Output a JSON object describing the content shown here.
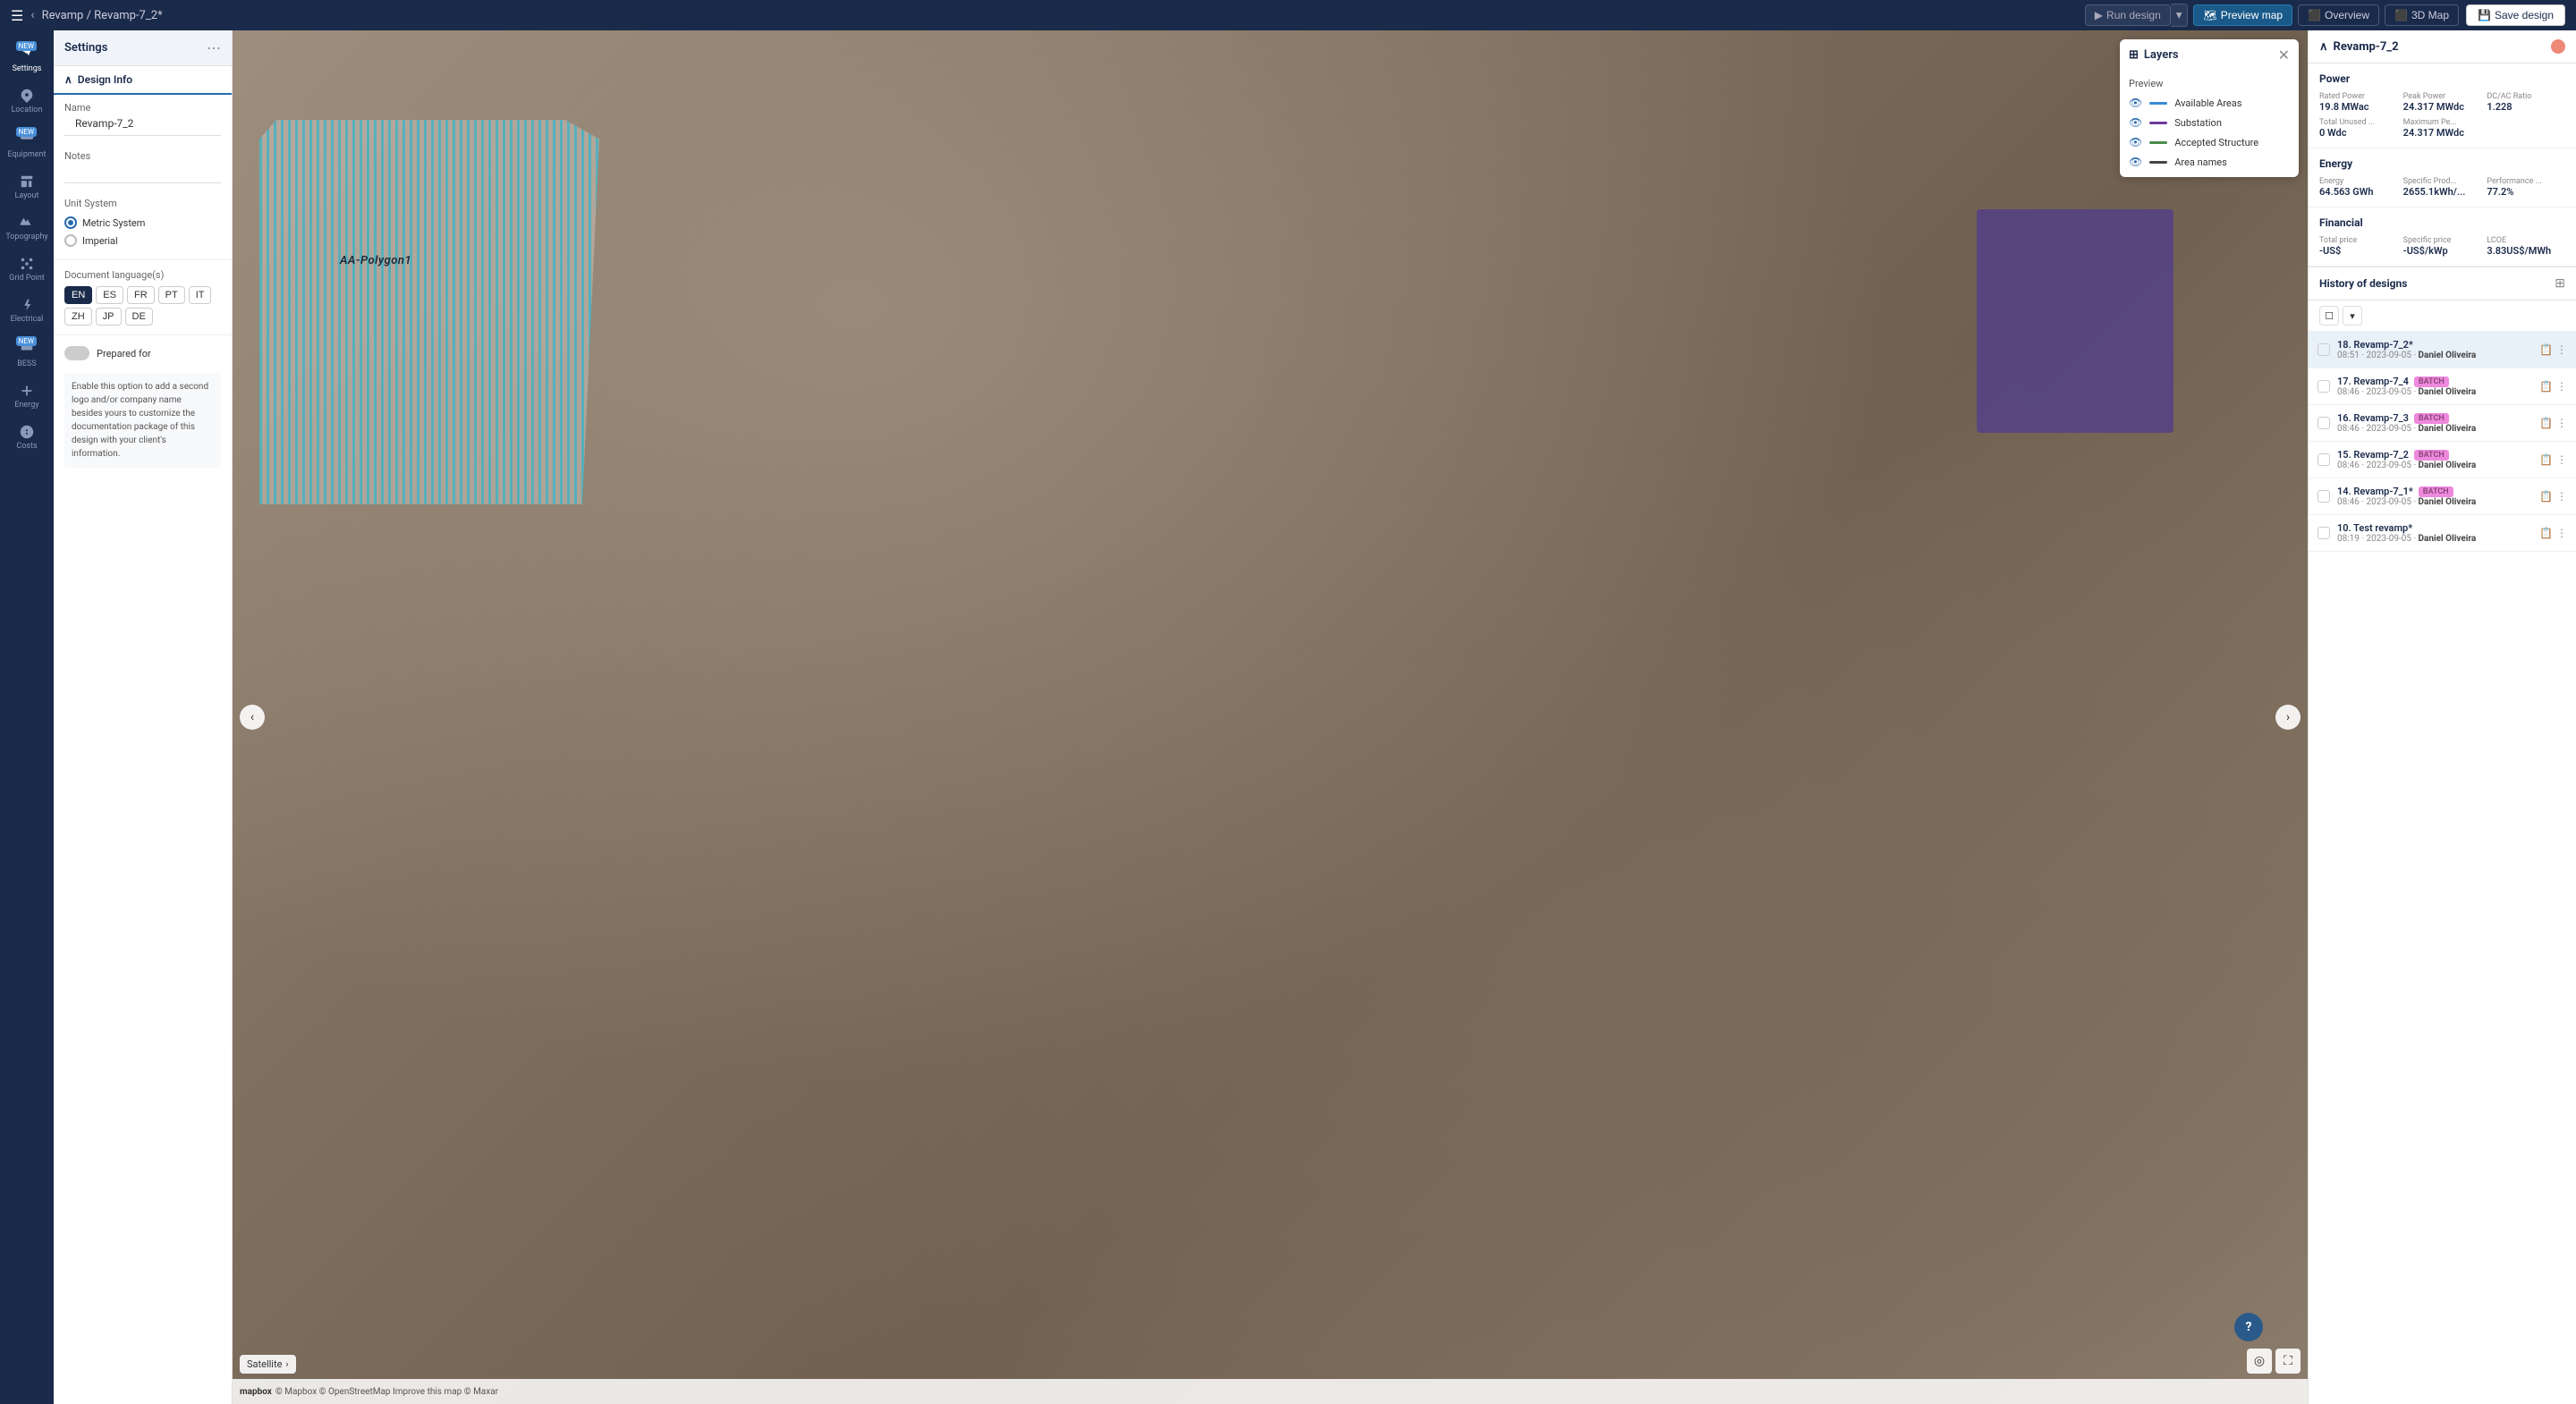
{
  "topbar": {
    "breadcrumb": "Revamp / Revamp-7_2*",
    "run_label": "Run design",
    "preview_label": "Preview map",
    "overview_label": "Overview",
    "map3d_label": "3D Map",
    "save_label": "Save design"
  },
  "sidebar": {
    "items": [
      {
        "id": "settings",
        "label": "Settings",
        "badge": "NEW"
      },
      {
        "id": "location",
        "label": "Location"
      },
      {
        "id": "equipment",
        "label": "Equipment",
        "badge": "NEW"
      },
      {
        "id": "layout",
        "label": "Layout"
      },
      {
        "id": "topography",
        "label": "Topography"
      },
      {
        "id": "gridpoint",
        "label": "Grid Point"
      },
      {
        "id": "electrical",
        "label": "Electrical"
      },
      {
        "id": "bess",
        "label": "BESS",
        "badge": "NEW"
      },
      {
        "id": "energy",
        "label": "Energy"
      },
      {
        "id": "costs",
        "label": "Costs"
      }
    ]
  },
  "settings_panel": {
    "title": "Settings",
    "design_info_label": "Design Info",
    "name_label": "Name",
    "name_value": "Revamp-7_2",
    "notes_label": "Notes",
    "notes_value": "",
    "unit_label": "Unit System",
    "metric_label": "Metric System",
    "imperial_label": "Imperial",
    "language_label": "Document language(s)",
    "languages": [
      "EN",
      "ES",
      "FR",
      "PT",
      "IT",
      "ZH",
      "JP",
      "DE"
    ],
    "active_lang": "EN",
    "prepared_for_label": "Prepared for",
    "info_text": "Enable this option to add a second logo and/or company name besides yours to customize the documentation package of this design with your client's information."
  },
  "map": {
    "polygon_label": "AA-Polygon1",
    "satellite_label": "Satellite",
    "mapbox_text": "© Mapbox © OpenStreetMap  Improve this map  © Maxar"
  },
  "layers": {
    "title": "Layers",
    "preview_label": "Preview",
    "items": [
      {
        "name": "Available Areas",
        "color": "#3a8ad4"
      },
      {
        "name": "Substation",
        "color": "#6a3a9a"
      },
      {
        "name": "Accepted Structure",
        "color": "#4a8a4a"
      },
      {
        "name": "Area names",
        "color": "#444444"
      }
    ]
  },
  "right_panel": {
    "design_name": "Revamp-7_2",
    "power": {
      "title": "Power",
      "rated_label": "Rated Power",
      "rated_value": "19.8 MWac",
      "peak_label": "Peak Power",
      "peak_value": "24.317 MWdc",
      "dcac_label": "DC/AC Ratio",
      "dcac_value": "1.228",
      "unused_label": "Total Unused ...",
      "unused_value": "0 Wdc",
      "maxpe_label": "Maximum Pe...",
      "maxpe_value": "24.317 MWdc"
    },
    "energy": {
      "title": "Energy",
      "energy_label": "Energy",
      "energy_value": "64.563 GWh",
      "specific_label": "Specific Prod...",
      "specific_value": "2655.1kWh/...",
      "perf_label": "Performance ...",
      "perf_value": "77.2%"
    },
    "financial": {
      "title": "Financial",
      "total_label": "Total price",
      "total_value": "-US$",
      "specific_label": "Specific price",
      "specific_value": "-US$/kWp",
      "lcoe_label": "LCOE",
      "lcoe_value": "3.83US$/MWh"
    },
    "history": {
      "title": "History of designs",
      "items": [
        {
          "id": 18,
          "name": "Revamp-7_2*",
          "time": "08:51",
          "date": "2023-09-05",
          "author": "Daniel Oliveira",
          "active": true,
          "badge": null
        },
        {
          "id": 17,
          "name": "Revamp-7_4",
          "time": "08:46",
          "date": "2023-09-05",
          "author": "Daniel Oliveira",
          "active": false,
          "badge": "BATCH"
        },
        {
          "id": 16,
          "name": "Revamp-7_3",
          "time": "08:46",
          "date": "2023-09-05",
          "author": "Daniel Oliveira",
          "active": false,
          "badge": "BATCH"
        },
        {
          "id": 15,
          "name": "Revamp-7_2",
          "time": "08:46",
          "date": "2023-09-05",
          "author": "Daniel Oliveira",
          "active": false,
          "badge": "BATCH"
        },
        {
          "id": 14,
          "name": "Revamp-7_1*",
          "time": "08:46",
          "date": "2023-09-05",
          "author": "Daniel Oliveira",
          "active": false,
          "badge": "BATCH"
        },
        {
          "id": 10,
          "name": "Test revamp*",
          "time": "08:19",
          "date": "2023-09-05",
          "author": "Daniel Oliveira",
          "active": false,
          "badge": null
        }
      ]
    }
  }
}
